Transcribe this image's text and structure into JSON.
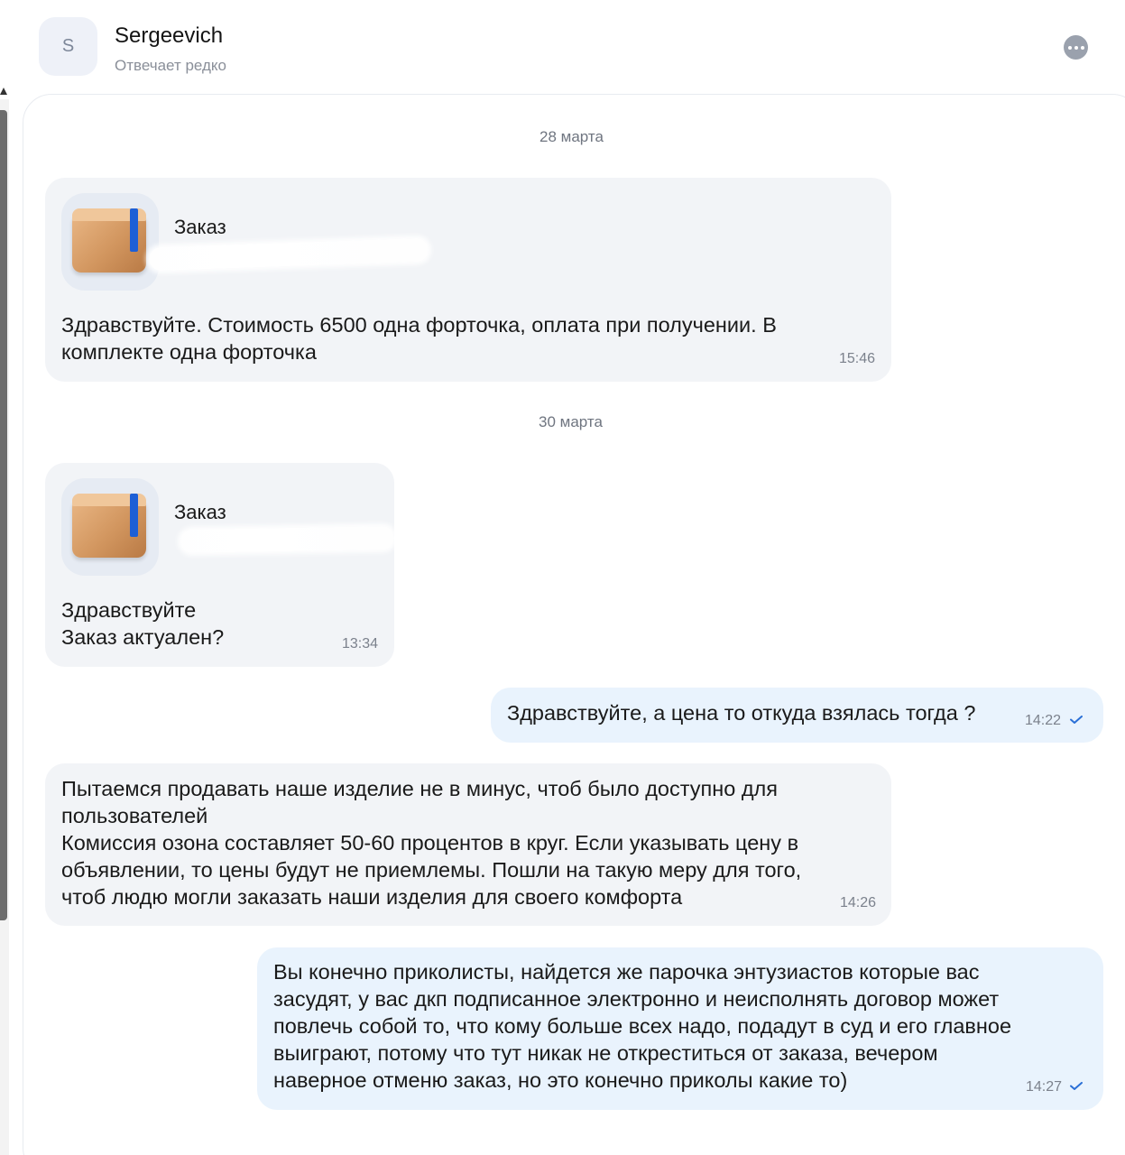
{
  "header": {
    "avatar_letter": "S",
    "name": "Sergeevich",
    "status": "Отвечает редко",
    "more_icon": "more-dots-icon"
  },
  "dates": [
    "28 марта",
    "30 марта"
  ],
  "messages": [
    {
      "direction": "incoming",
      "order_title": "Заказ",
      "text": "Здравствуйте. Стоимость 6500 одна форточка, оплата при получении. В\nкомплекте одна форточка",
      "time": "15:46"
    },
    {
      "direction": "incoming",
      "order_title": "Заказ",
      "text": "Здравствуйте\nЗаказ актуален?",
      "time": "13:34"
    },
    {
      "direction": "outgoing",
      "text": "Здравствуйте, а цена то откуда взялась тогда ?",
      "time": "14:22",
      "read": true
    },
    {
      "direction": "incoming",
      "text": "Пытаемся продавать наше изделие не в минус, чтоб было доступно для\nпользователей\nКомиссия озона составляет 50-60 процентов в круг. Если указывать цену в\nобъявлении, то цены будут не приемлемы. Пошли на такую меру для того,\nчтоб людю могли заказать наши изделия для своего комфорта",
      "time": "14:26"
    },
    {
      "direction": "outgoing",
      "text": "Вы конечно приколисты, найдется же парочка энтузиастов которые вас\nзасудят, у вас дкп подписанное электронно и неисполнять договор может\nповлечь собой то, что кому больше всех надо, подадут в суд и его главное\nвыиграют, потому что тут никак не откреститься от заказа, вечером\nнаверное отменю заказ, но это конечно приколы какие то)",
      "time": "14:27",
      "read": true
    }
  ],
  "colors": {
    "incoming_bubble": "#f2f4f7",
    "outgoing_bubble": "#e9f3fd",
    "read_check": "#2a6fd6"
  }
}
